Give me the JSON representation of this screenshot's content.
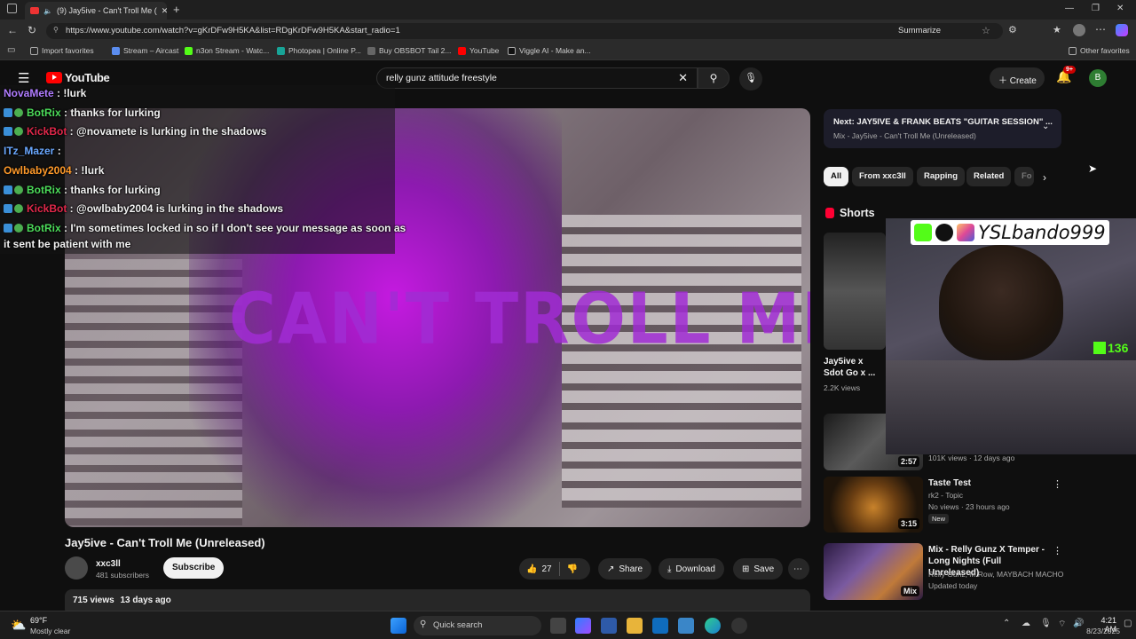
{
  "browser": {
    "tab_title": "(9) Jay5ive - Can't Troll Me (",
    "url": "https://www.youtube.com/watch?v=gKrDFw9H5KA&list=RDgKrDFw9H5KA&start_radio=1",
    "summarize_label": "Summarize",
    "bookmarks": [
      "Import favorites",
      "Stream – Aircast",
      "n3on Stream - Watc...",
      "Photopea | Online P...",
      "Buy OBSBOT Tail 2...",
      "YouTube",
      "Viggle AI - Make an..."
    ],
    "other_favorites": "Other favorites"
  },
  "youtube": {
    "logo_text": "YouTube",
    "search_value": "relly gunz attitude freestyle",
    "create_label": "Create",
    "notif_count": "9+",
    "avatar_letter": "B"
  },
  "chat": [
    {
      "user": "NovaMete",
      "msg": ": !lurk",
      "color": "#b07cff",
      "badges": false
    },
    {
      "user": "BotRix",
      "msg": ": thanks for lurking",
      "color": "#4cdc5a",
      "badges": true
    },
    {
      "user": "KickBot",
      "msg": ": @novamete is lurking in the shadows",
      "color": "#e0284a",
      "badges": true
    },
    {
      "user": "ITz_Mazer",
      "msg": ":",
      "color": "#6aa8ff",
      "badges": false
    },
    {
      "user": "Owlbaby2004",
      "msg": ": !lurk",
      "color": "#ff9a2a",
      "badges": false
    },
    {
      "user": "BotRix",
      "msg": ": thanks for lurking",
      "color": "#4cdc5a",
      "badges": true
    },
    {
      "user": "KickBot",
      "msg": ": @owlbaby2004 is lurking in the shadows",
      "color": "#e0284a",
      "badges": true
    },
    {
      "user": "BotRix",
      "msg": ": I'm sometimes locked in so if I don't see your message as soon as",
      "color": "#4cdc5a",
      "badges": true
    }
  ],
  "chat_continuation": "it sent be patient with me",
  "video": {
    "overlay_text": "CAN'T TROLL ME",
    "title": "Jay5ive - Can't Troll Me (Unreleased)",
    "channel": "xxc3ll",
    "subscribers": "481 subscribers",
    "subscribe_label": "Subscribe",
    "likes": "27",
    "share_label": "Share",
    "download_label": "Download",
    "save_label": "Save",
    "views": "715 views",
    "age": "13 days ago"
  },
  "up_next": {
    "title": "Next: JAY5IVE & FRANK BEATS \"GUITAR SESSION\" ...",
    "subtitle": "Mix - Jay5ive - Can't Troll Me (Unreleased)"
  },
  "chips": [
    "All",
    "From xxc3ll",
    "Rapping",
    "Related",
    "Fo"
  ],
  "shorts": {
    "heading": "Shorts",
    "item_title": "Jay5ive x Sdot Go x ...",
    "item_views": "2.2K views"
  },
  "related": [
    {
      "title": "",
      "channel": "",
      "meta": "101K views · 12 days ago",
      "duration": "2:57",
      "badge": ""
    },
    {
      "title": "Taste Test",
      "channel": "rk2 - Topic",
      "meta": "No views · 23 hours ago",
      "duration": "3:15",
      "badge": "New"
    },
    {
      "title": "Mix - Relly Gunz X Temper - Long Nights (Full Unreleased)",
      "channel": "Relly Gunz, M Row, MAYBACH MACHO, a...",
      "meta": "Updated today",
      "duration": "Mix",
      "badge": ""
    }
  ],
  "webcam": {
    "name": "YSLbando999",
    "viewer_count": "136"
  },
  "taskbar": {
    "temp": "69°F",
    "weather": "Mostly clear",
    "search_placeholder": "Quick search",
    "time": "4:21 AM",
    "date": "8/23/2025"
  },
  "colors": {
    "yt_red": "#ff0000",
    "accent_purple": "#a12cd4",
    "kick_green": "#53fc18"
  }
}
